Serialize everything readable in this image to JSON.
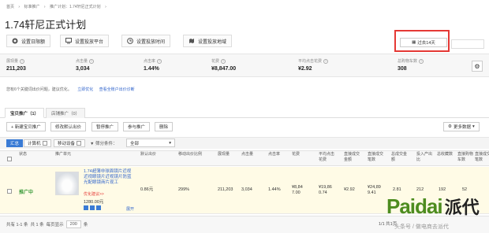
{
  "breadcrumb": [
    "首页",
    "›",
    "标准推广",
    "›",
    "推广计划：1.74轩尼正式计划",
    "›"
  ],
  "page_title": "1.74轩尼正式计划",
  "actions": [
    {
      "label": "设置日限额",
      "icon": "coin-icon"
    },
    {
      "label": "设置投放平台",
      "icon": "monitor-icon"
    },
    {
      "label": "设置投放时间",
      "icon": "clock-icon"
    },
    {
      "label": "设置投放地域",
      "icon": "map-icon"
    }
  ],
  "date_range": "过去14天",
  "metrics": [
    {
      "label": "展现量",
      "value": "211,203"
    },
    {
      "label": "点击量",
      "value": "3,034"
    },
    {
      "label": "点击率",
      "value": "1.44%"
    },
    {
      "label": "花费",
      "value": "¥8,847.00"
    },
    {
      "label": "平均点击花费",
      "value": "¥2.92"
    },
    {
      "label": "总购物车数",
      "value": "308"
    }
  ],
  "notice": {
    "text": "您有6个关键词出价问题，建议优化。",
    "link1": "立即优化",
    "link2": "查看全账户出价诊断"
  },
  "tabs": [
    {
      "label": "宝贝推广（1）",
      "active": true
    },
    {
      "label": "店铺推广（0）",
      "active": false
    }
  ],
  "toolbar": {
    "new": "+ 新建宝贝推广",
    "modify_bid": "修改默认出价",
    "pause": "暂停推广",
    "resume": "参与推广",
    "delete": "删除",
    "more_data": "更多数据"
  },
  "filters": {
    "summary": "汇总",
    "pc": "计算机",
    "mobile": "移动设备",
    "condition_label": "▼ 筛分条件：",
    "condition_value": "全部"
  },
  "table": {
    "headers": [
      "状态",
      "推广单元",
      "默认出价",
      "移动出价比例",
      "展现量",
      "点击量",
      "点击率",
      "花费",
      "平均点击\n花费",
      "直接成交\n金额",
      "直接成交\n笔数",
      "总成交金\n额",
      "投入产出\n比",
      "总收藏数",
      "直接购物\n车数",
      "直接成交\n笔数"
    ],
    "row": {
      "status": "推广中",
      "product_name": "1.74超薄非球面镜片近视\n近视眼镜片近视镜片防蓝\n光配眼镜商片现工",
      "promo": "优化建议>>",
      "price": "1280.00元",
      "expand": "展开",
      "default_bid": "0.86元",
      "mobile_ratio": "299%",
      "impressions": "211,203",
      "clicks": "3,034",
      "ctr": "1.44%",
      "cost": "¥8,84\n7.00",
      "direct_amount": "¥19,86\n0.74",
      "avg_cpc": "¥2.92",
      "total_amount": "¥24,89\n9.41",
      "roi": "2.81",
      "favorites": "212",
      "cart": "192",
      "orders": "52"
    }
  },
  "footer": {
    "count": "共有 1-1 条",
    "total": "共 1 条",
    "per_page_label": "每页显示",
    "per_page": "200",
    "per_page_unit": "条",
    "page_info": "1/1 共1页"
  },
  "watermark": {
    "brand": "Paidai",
    "cn": "派代",
    "sub": "头条号 / 做电商去派代"
  },
  "colors": {
    "accent": "#3a7bd5",
    "status_green": "#3a9a3a",
    "highlight_red": "#e53935",
    "brand_green": "#4d8c1f"
  }
}
